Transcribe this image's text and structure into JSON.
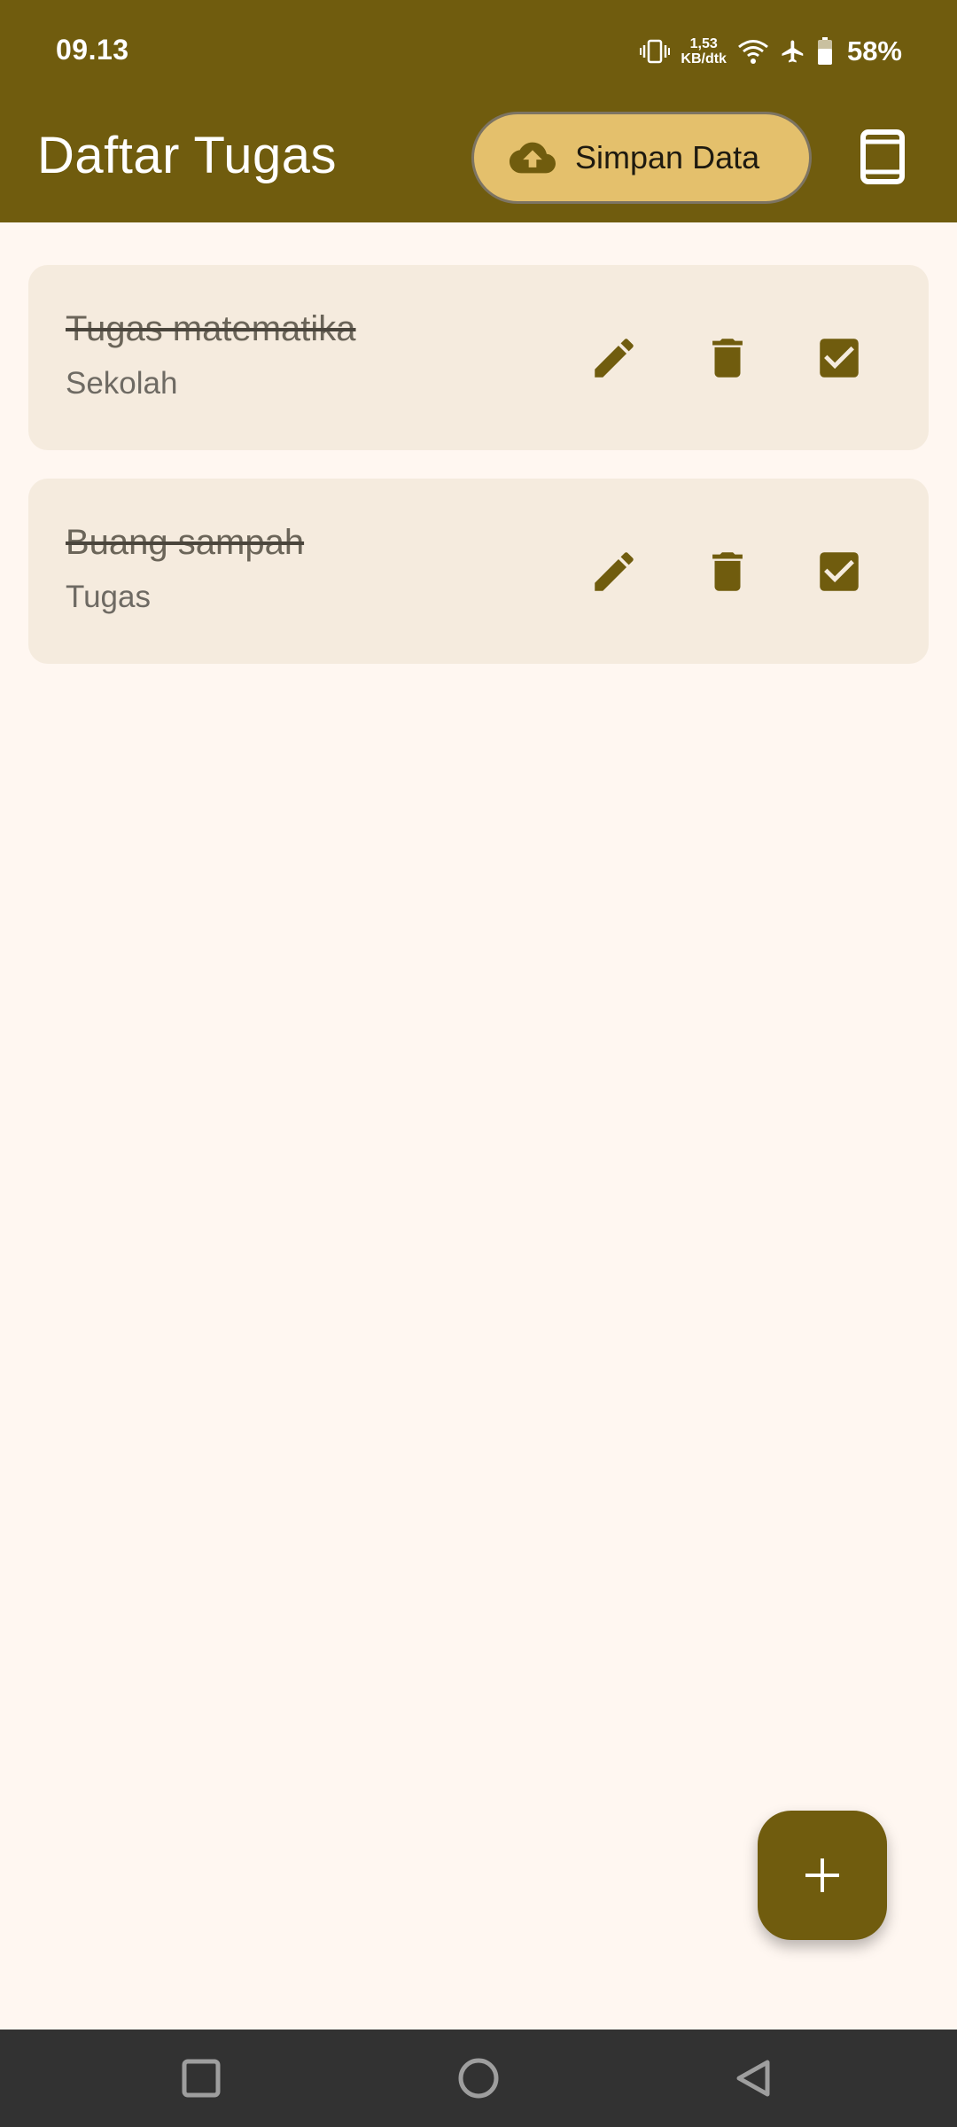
{
  "status_bar": {
    "time": "09.13",
    "net_speed_value": "1,53",
    "net_speed_unit": "KB/dtk",
    "battery": "58%",
    "icons": [
      "vibrate-icon",
      "wifi-icon",
      "airplane-mode-icon",
      "battery-icon"
    ]
  },
  "app_bar": {
    "title": "Daftar Tugas",
    "save_button_label": "Simpan Data",
    "save_button_icon": "cloud-upload-icon",
    "device_icon": "phone-icon"
  },
  "tasks": [
    {
      "title": "Tugas matematika",
      "category": "Sekolah",
      "done": true
    },
    {
      "title": "Buang sampah",
      "category": "Tugas",
      "done": true
    }
  ],
  "fab_icon": "add-icon",
  "nav_bar": [
    "recents-icon",
    "home-icon",
    "back-icon"
  ],
  "colors": {
    "primary": "#705c0e",
    "background": "#fff7f1",
    "card": "#f5ebde",
    "save_button": "#e4c06c",
    "nav_bar": "#323232"
  }
}
